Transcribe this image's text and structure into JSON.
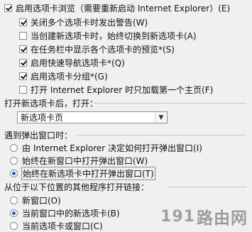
{
  "tabbed_browsing": {
    "enable_label": "启用选项卡浏览（需要重新启动 Internet Explorer）(E)",
    "enable_checked": true,
    "options": [
      {
        "label": "关闭多个选项卡时发出警告(W)",
        "checked": true
      },
      {
        "label": "当创建新选项卡时，始终切换到新选项卡(A)",
        "checked": false
      },
      {
        "label": "在任务栏中显示各个选项卡的预览*(S)",
        "checked": true
      },
      {
        "label": "启用快速导航选项卡*(Q)",
        "checked": true
      },
      {
        "label": "启用选项卡分组*(G)",
        "checked": true
      },
      {
        "label": "打开 Internet Explorer 时只加载第一个主页(F)",
        "checked": false
      }
    ]
  },
  "new_tab": {
    "heading": "打开新选项卡后，打开：",
    "selected": "新选项卡页"
  },
  "popups": {
    "heading": "遇到弹出窗口时：",
    "options": [
      {
        "label": "由 Internet Explorer 决定如何打开弹出窗口(I)",
        "checked": false
      },
      {
        "label": "始终在新窗口中打开弹出窗口(W)",
        "checked": false
      },
      {
        "label": "始终在新选项卡中打开弹出窗口(T)",
        "checked": true
      }
    ]
  },
  "external_links": {
    "heading": "从位于以下位置的其他程序打开链接：",
    "options": [
      {
        "label": "新窗口(O)",
        "checked": false
      },
      {
        "label": "当前窗口中的新选项卡(B)",
        "checked": true
      },
      {
        "label": "当前选项卡或窗口(C)",
        "checked": false
      }
    ]
  },
  "watermark": {
    "number": "191",
    "text": "路由网"
  }
}
